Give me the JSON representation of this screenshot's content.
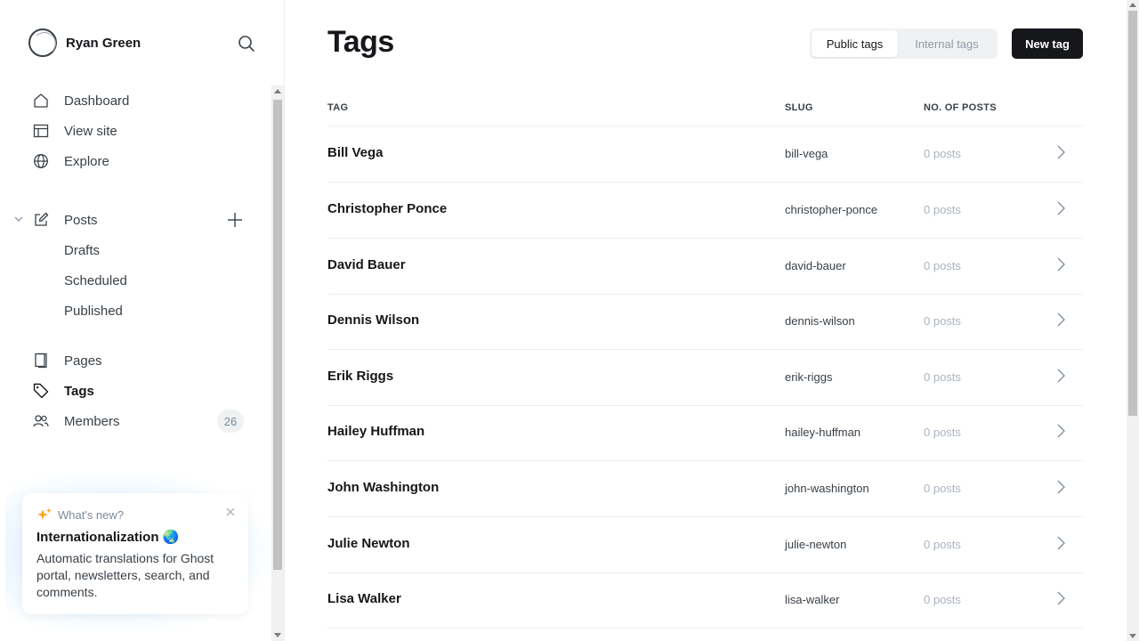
{
  "sidebar": {
    "user_name": "Ryan Green",
    "nav": {
      "dashboard": "Dashboard",
      "view_site": "View site",
      "explore": "Explore",
      "posts": "Posts",
      "drafts": "Drafts",
      "scheduled": "Scheduled",
      "published": "Published",
      "pages": "Pages",
      "tags": "Tags",
      "members": "Members",
      "members_count": "26"
    },
    "whats_new": {
      "label": "What's new?",
      "title": "Internationalization 🌏",
      "body": "Automatic translations for Ghost portal, newsletters, search, and comments."
    }
  },
  "main": {
    "title": "Tags",
    "filter": {
      "public": "Public tags",
      "internal": "Internal tags",
      "selected": "Public tags"
    },
    "new_tag": "New tag",
    "columns": {
      "tag": "TAG",
      "slug": "SLUG",
      "posts": "NO. OF POSTS"
    },
    "rows": [
      {
        "name": "Bill Vega",
        "slug": "bill-vega",
        "count": "0 posts"
      },
      {
        "name": "Christopher Ponce",
        "slug": "christopher-ponce",
        "count": "0 posts"
      },
      {
        "name": "David Bauer",
        "slug": "david-bauer",
        "count": "0 posts"
      },
      {
        "name": "Dennis Wilson",
        "slug": "dennis-wilson",
        "count": "0 posts"
      },
      {
        "name": "Erik Riggs",
        "slug": "erik-riggs",
        "count": "0 posts"
      },
      {
        "name": "Hailey Huffman",
        "slug": "hailey-huffman",
        "count": "0 posts"
      },
      {
        "name": "John Washington",
        "slug": "john-washington",
        "count": "0 posts"
      },
      {
        "name": "Julie Newton",
        "slug": "julie-newton",
        "count": "0 posts"
      },
      {
        "name": "Lisa Walker",
        "slug": "lisa-walker",
        "count": "0 posts"
      }
    ]
  },
  "colors": {
    "text": "#15171a",
    "muted": "#abb4be",
    "border": "#ebeef0",
    "button_dark": "#15171a"
  }
}
